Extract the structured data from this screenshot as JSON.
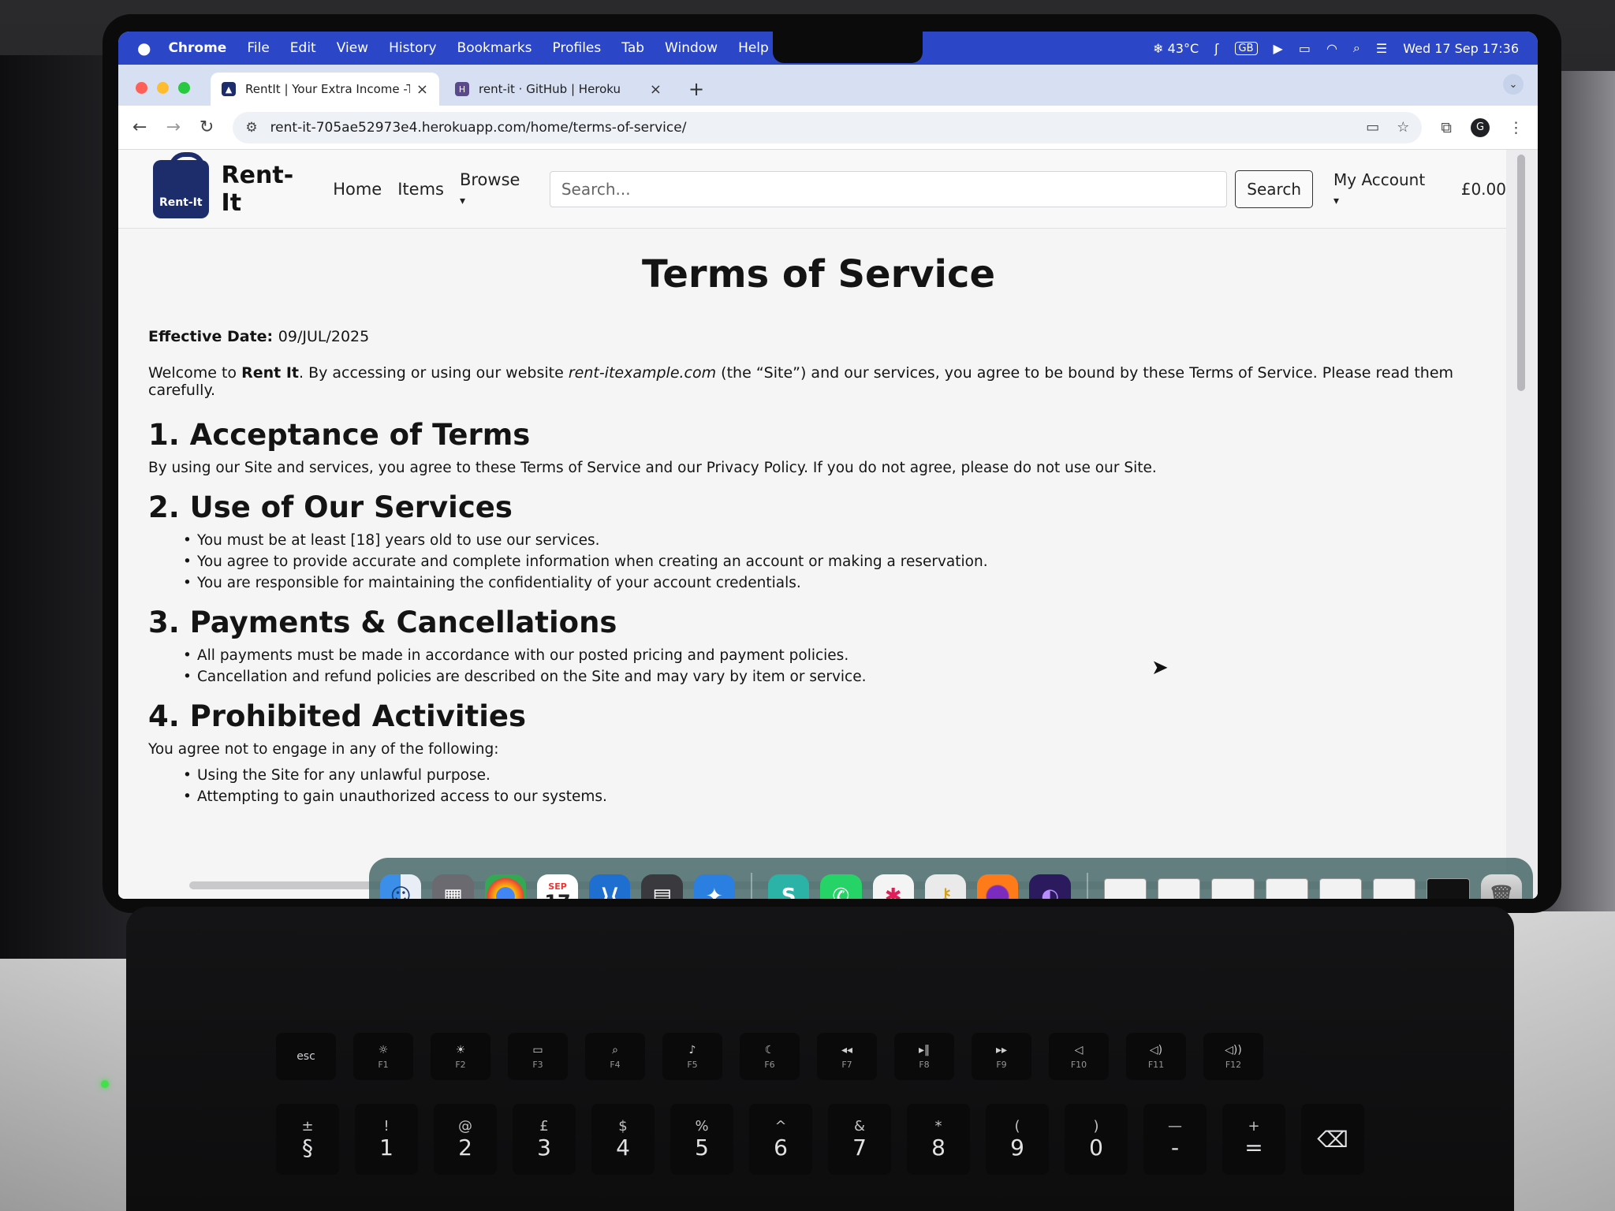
{
  "menubar": {
    "app": "Chrome",
    "items": [
      "File",
      "Edit",
      "View",
      "History",
      "Bookmarks",
      "Profiles",
      "Tab",
      "Window",
      "Help"
    ],
    "temp": "43°C",
    "gb": "GB",
    "datetime": "Wed 17 Sep  17:36"
  },
  "tabs": [
    {
      "title": "RentIt | Your Extra Income -Te",
      "icon": "bag-icon"
    },
    {
      "title": "rent-it · GitHub | Heroku",
      "icon": "heroku-icon"
    }
  ],
  "toolbar": {
    "url": "rent-it-705ae52973e4.herokuapp.com/home/terms-of-service/",
    "profile": "G"
  },
  "site_nav": {
    "logo_text": "Rent-It",
    "brand": "Rent-It",
    "links": [
      "Home",
      "Items",
      "Browse"
    ],
    "search_placeholder": "Search...",
    "search_button": "Search",
    "account": "My Account",
    "cart": "£0.00"
  },
  "content": {
    "title": "Terms of Service",
    "effective_label": "Effective Date:",
    "effective_value": "09/JUL/2025",
    "intro": {
      "pre": "Welcome to ",
      "brand": "Rent It",
      "mid": ". By accessing or using our website ",
      "site": "rent-itexample.com",
      "post": " (the “Site”) and our services, you agree to be bound by these Terms of Service. Please read them carefully."
    },
    "sections": [
      {
        "heading": "1. Acceptance of Terms",
        "text": "By using our Site and services, you agree to these Terms of Service and our Privacy Policy. If you do not agree, please do not use our Site.",
        "items": []
      },
      {
        "heading": "2. Use of Our Services",
        "text": "",
        "items": [
          "You must be at least [18] years old to use our services.",
          "You agree to provide accurate and complete information when creating an account or making a reservation.",
          "You are responsible for maintaining the confidentiality of your account credentials."
        ]
      },
      {
        "heading": "3. Payments & Cancellations",
        "text": "",
        "items": [
          "All payments must be made in accordance with our posted pricing and payment policies.",
          "Cancellation and refund policies are described on the Site and may vary by item or service."
        ]
      },
      {
        "heading": "4. Prohibited Activities",
        "text": "You agree not to engage in any of the following:",
        "items": [
          "Using the Site for any unlawful purpose.",
          "Attempting to gain unauthorized access to our systems."
        ]
      }
    ]
  },
  "dock": {
    "calendar_month": "SEP",
    "calendar_day": "17"
  },
  "keyboard": {
    "esc": "esc",
    "fkeys": [
      "F1",
      "F2",
      "F3",
      "F4",
      "F5",
      "F6",
      "F7",
      "F8",
      "F9",
      "F10",
      "F11",
      "F12"
    ],
    "numbers": [
      [
        "±",
        "§"
      ],
      [
        "!",
        "1"
      ],
      [
        "@",
        "2"
      ],
      [
        "£",
        "3"
      ],
      [
        "$",
        "4"
      ],
      [
        "%",
        "5"
      ],
      [
        "^",
        "6"
      ],
      [
        "&",
        "7"
      ],
      [
        "*",
        "8"
      ],
      [
        "(",
        "9"
      ],
      [
        ")",
        "0"
      ],
      [
        "—",
        "-"
      ],
      [
        "+",
        "="
      ]
    ]
  },
  "colors": {
    "menubar": "#2b46c7",
    "tabbar": "#d6e0f2",
    "logo": "#1d2c6b"
  }
}
